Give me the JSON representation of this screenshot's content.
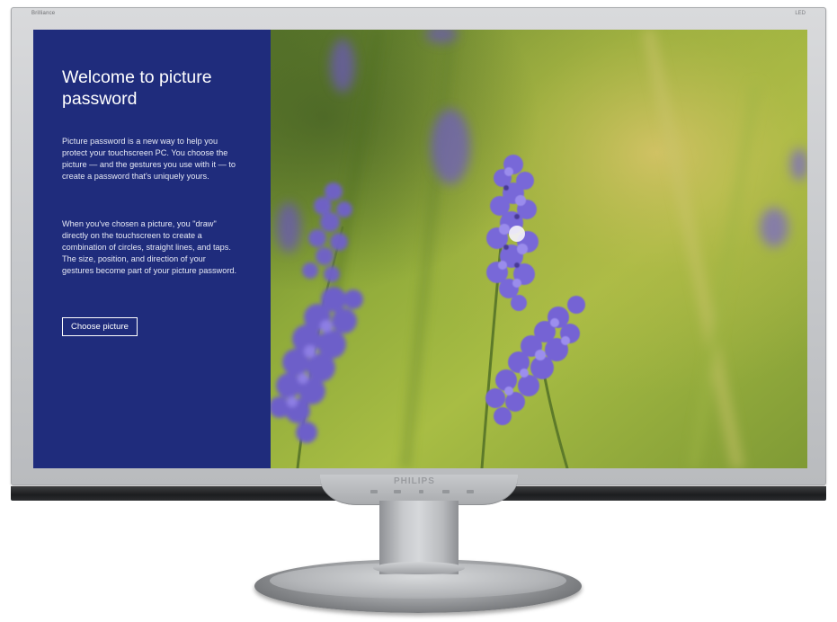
{
  "monitor": {
    "brand_top_left": "Brilliance",
    "brand_top_right": "LED",
    "logo": "PHILIPS"
  },
  "welcome": {
    "title": "Welcome to picture password",
    "paragraph1": "Picture password is a new way to help you protect your touchscreen PC. You choose the picture — and the gestures you use with it — to create a password that's uniquely yours.",
    "paragraph2": "When you've chosen a picture, you \"draw\" directly on the touchscreen to create a combination of circles, straight lines, and taps. The size, position, and direction of your gestures become part of your picture password.",
    "choose_button": "Choose picture"
  },
  "picture": {
    "subject": "lavender-flowers",
    "tap_indicator": "tap-dot"
  },
  "colors": {
    "panel_blue": "#1f2c7c",
    "accent_white": "#ffffff",
    "lavender": "#6a5ad0",
    "grass_green": "#8fb03a"
  }
}
